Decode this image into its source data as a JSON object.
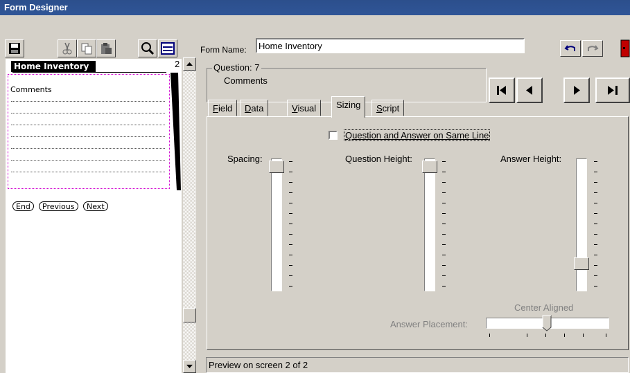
{
  "window": {
    "title": "Form Designer"
  },
  "toolbar": {
    "icons": [
      "save-icon",
      "cut-icon",
      "copy-icon",
      "paste-icon",
      "search-icon",
      "properties-icon"
    ],
    "form_name_label": "Form Name:",
    "form_name_value": "Home Inventory",
    "undo_icon": "undo-icon",
    "redo_icon": "redo-icon",
    "exit_icon": "exit-door-icon"
  },
  "preview": {
    "form_title": "Home Inventory",
    "page_number": "2",
    "question_label": "Comments",
    "nav_buttons": [
      "End",
      "Previous",
      "Next"
    ]
  },
  "question": {
    "legend": "Question: 7",
    "name": "Comments",
    "nav_icons": [
      "first-icon",
      "previous-icon",
      "next-icon",
      "last-icon"
    ]
  },
  "tabs": [
    {
      "label": "Field",
      "u": "F",
      "rest": "ield",
      "active": false
    },
    {
      "label": "Data",
      "u": "D",
      "rest": "ata",
      "active": false
    },
    {
      "label": "Visual",
      "u": "V",
      "rest": "isual",
      "active": false
    },
    {
      "label": "Sizing",
      "u": "",
      "rest": "Sizing",
      "active": true
    },
    {
      "label": "Script",
      "u": "S",
      "rest": "cript",
      "active": false
    }
  ],
  "sizing": {
    "same_line_label": "Question and Answer on Same Line",
    "same_line_checked": false,
    "spacing_label": "Spacing:",
    "spacing_level": 0.0,
    "question_height_label": "Question Height:",
    "question_height_level": 0.0,
    "answer_height_label": "Answer Height:",
    "answer_height_level": 0.85,
    "answer_placement_label": "Answer Placement:",
    "center_aligned_label": "Center Aligned",
    "answer_placement_level": 0.5
  },
  "status": {
    "text": "Preview on screen 2 of 2"
  },
  "colors": {
    "titlebar": "#2f5597",
    "face": "#d4d0c8",
    "door": "#c00000"
  }
}
